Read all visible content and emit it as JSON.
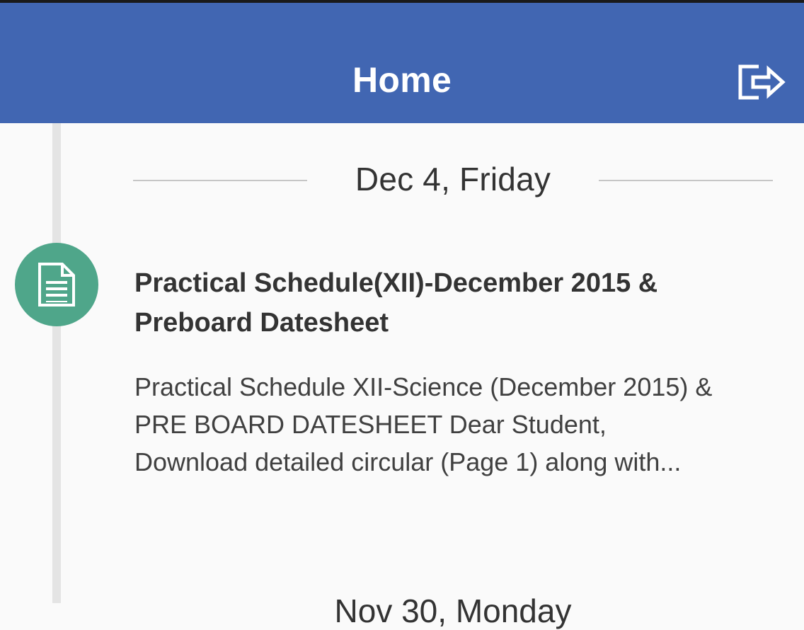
{
  "header": {
    "title": "Home",
    "logout_icon": "logout-icon",
    "background_color": "#4166b2"
  },
  "timeline": {
    "groups": [
      {
        "date_label": "Dec 4, Friday",
        "items": [
          {
            "icon": "document-icon",
            "icon_color": "#4fa68a",
            "title": "Practical Schedule(XII)-December 2015 & Preboard Datesheet",
            "description": "Practical Schedule XII-Science (December 2015) &\nPRE BOARD DATESHEET   Dear Student,\nDownload detailed circular (Page 1) along with..."
          }
        ]
      },
      {
        "date_label": "Nov 30, Monday"
      }
    ]
  }
}
